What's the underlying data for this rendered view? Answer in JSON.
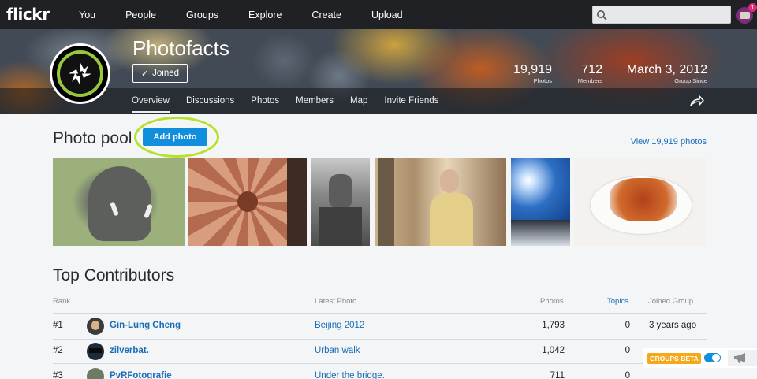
{
  "nav": {
    "logo": "flickr",
    "links": [
      "You",
      "People",
      "Groups",
      "Explore",
      "Create",
      "Upload"
    ],
    "search_placeholder": "",
    "notification_count": "1"
  },
  "group": {
    "name": "Photofacts",
    "joined_label": "Joined",
    "stats": [
      {
        "value": "19,919",
        "label": "Photos"
      },
      {
        "value": "712",
        "label": "Members"
      },
      {
        "value": "March 3, 2012",
        "label": "Group Since"
      }
    ],
    "tabs": [
      "Overview",
      "Discussions",
      "Photos",
      "Members",
      "Map",
      "Invite Friends"
    ],
    "active_tab": "Overview"
  },
  "pool": {
    "title": "Photo pool",
    "add_label": "Add photo",
    "view_all": "View 19,919 photos",
    "photos": [
      "elephant",
      "vaulted-ceiling",
      "statue",
      "woman-portrait",
      "sun-sky",
      "food-plate"
    ]
  },
  "contributors": {
    "title": "Top Contributors",
    "headers": {
      "rank": "Rank",
      "latest": "Latest Photo",
      "photos": "Photos",
      "topics": "Topics",
      "joined": "Joined Group"
    },
    "rows": [
      {
        "rank": "#1",
        "name": "Gin-Lung Cheng",
        "latest": "Beijing 2012",
        "photos": "1,793",
        "topics": "0",
        "joined": "3 years ago"
      },
      {
        "rank": "#2",
        "name": "zilverbat.",
        "latest": "Urban walk",
        "photos": "1,042",
        "topics": "0",
        "joined": ""
      },
      {
        "rank": "#3",
        "name": "PvRFotografie",
        "latest": "Under the bridge.",
        "photos": "711",
        "topics": "0",
        "joined": ""
      }
    ]
  },
  "beta": {
    "label": "GROUPS BETA",
    "enabled": true
  },
  "colors": {
    "accent": "#128fdc",
    "link": "#1a6db6",
    "highlight": "#b7e22b",
    "nav_bg": "#202124"
  }
}
